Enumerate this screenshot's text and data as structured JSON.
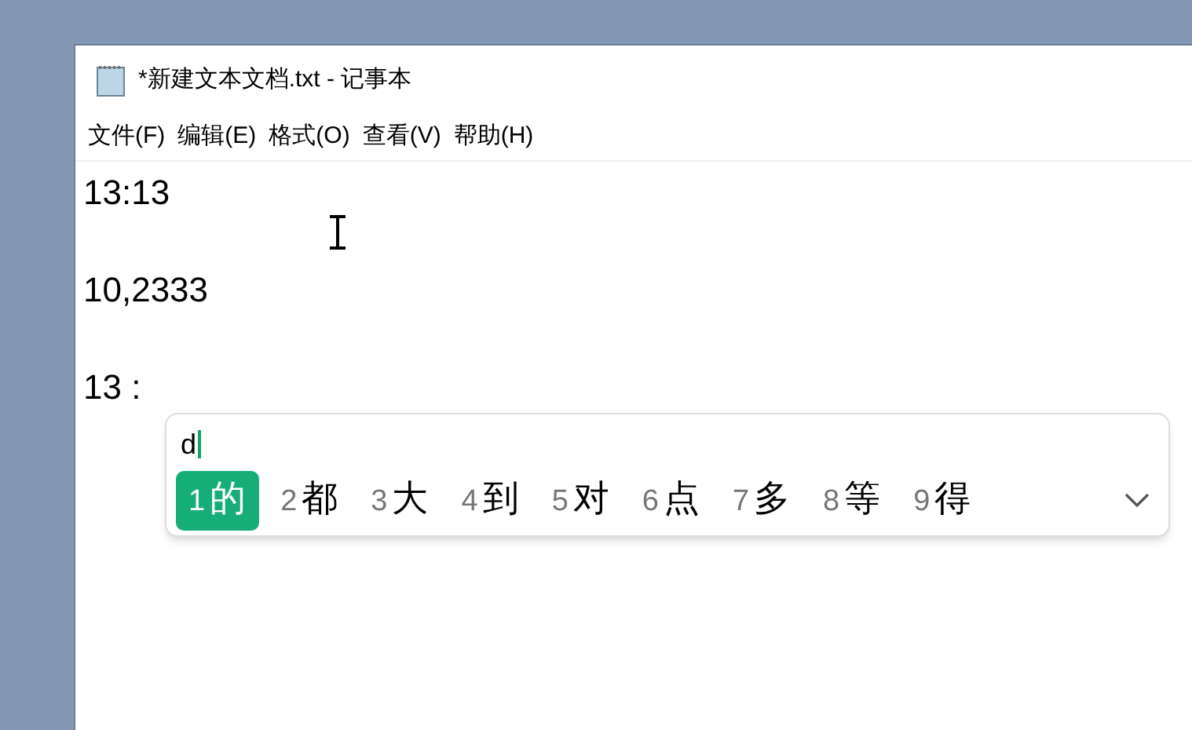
{
  "window": {
    "title": "*新建文本文档.txt - 记事本"
  },
  "menu": [
    "文件(F)",
    "编辑(E)",
    "格式(O)",
    "查看(V)",
    "帮助(H)"
  ],
  "editor": {
    "lines": [
      "13:13",
      "10,2333",
      "13 :"
    ]
  },
  "ime": {
    "composition": "d",
    "candidates": [
      {
        "number": "1",
        "text": "的",
        "selected": true
      },
      {
        "number": "2",
        "text": "都",
        "selected": false
      },
      {
        "number": "3",
        "text": "大",
        "selected": false
      },
      {
        "number": "4",
        "text": "到",
        "selected": false
      },
      {
        "number": "5",
        "text": "对",
        "selected": false
      },
      {
        "number": "6",
        "text": "点",
        "selected": false
      },
      {
        "number": "7",
        "text": "多",
        "selected": false
      },
      {
        "number": "8",
        "text": "等",
        "selected": false
      },
      {
        "number": "9",
        "text": "得",
        "selected": false
      }
    ]
  }
}
